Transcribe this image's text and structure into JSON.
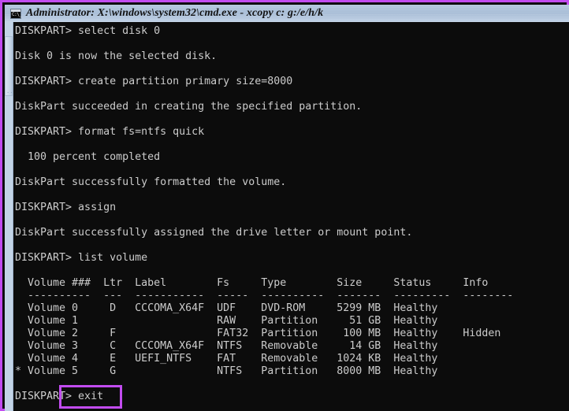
{
  "window": {
    "title": "Administrator: X:\\windows\\system32\\cmd.exe - xcopy  c: g:/e/h/k",
    "icon_name": "cmd-console-icon",
    "icon_glyph": "C:\\_",
    "border_color": "#c24cf0",
    "titlebar_color": "#b0c4da",
    "console_bg": "#0c0c0c",
    "console_fg": "#cccccc"
  },
  "scrollbar": {
    "name": "vertical-scrollbar",
    "dots": "···"
  },
  "console": {
    "lines": [
      "DISKPART> select disk 0",
      "",
      "Disk 0 is now the selected disk.",
      "",
      "DISKPART> create partition primary size=8000",
      "",
      "DiskPart succeeded in creating the specified partition.",
      "",
      "DISKPART> format fs=ntfs quick",
      "",
      "  100 percent completed",
      "",
      "DiskPart successfully formatted the volume.",
      "",
      "DISKPART> assign",
      "",
      "DiskPart successfully assigned the drive letter or mount point.",
      "",
      "DISKPART> list volume",
      "",
      "  Volume ###  Ltr  Label        Fs     Type        Size     Status     Info",
      "  ----------  ---  -----------  -----  ----------  -------  ---------  --------",
      "  Volume 0     D   CCCOMA_X64F  UDF    DVD-ROM     5299 MB  Healthy",
      "  Volume 1                      RAW    Partition     51 GB  Healthy",
      "  Volume 2     F                FAT32  Partition    100 MB  Healthy    Hidden",
      "  Volume 3     C   CCCOMA_X64F  NTFS   Removable     14 GB  Healthy",
      "  Volume 4     E   UEFI_NTFS    FAT    Removable   1024 KB  Healthy",
      "* Volume 5     G                NTFS   Partition   8000 MB  Healthy",
      "",
      "DISKPART> exit"
    ]
  },
  "annotation": {
    "name": "exit-command-highlight",
    "target_text": "> exit",
    "color": "#c24cf0"
  },
  "terminal_table": {
    "headers": [
      "Volume ###",
      "Ltr",
      "Label",
      "Fs",
      "Type",
      "Size",
      "Status",
      "Info"
    ],
    "rows": [
      {
        "selected": false,
        "volume": "Volume 0",
        "ltr": "D",
        "label": "CCCOMA_X64F",
        "fs": "UDF",
        "type": "DVD-ROM",
        "size": "5299 MB",
        "status": "Healthy",
        "info": ""
      },
      {
        "selected": false,
        "volume": "Volume 1",
        "ltr": "",
        "label": "",
        "fs": "RAW",
        "type": "Partition",
        "size": "51 GB",
        "status": "Healthy",
        "info": ""
      },
      {
        "selected": false,
        "volume": "Volume 2",
        "ltr": "F",
        "label": "",
        "fs": "FAT32",
        "type": "Partition",
        "size": "100 MB",
        "status": "Healthy",
        "info": "Hidden"
      },
      {
        "selected": false,
        "volume": "Volume 3",
        "ltr": "C",
        "label": "CCCOMA_X64F",
        "fs": "NTFS",
        "type": "Removable",
        "size": "14 GB",
        "status": "Healthy",
        "info": ""
      },
      {
        "selected": false,
        "volume": "Volume 4",
        "ltr": "E",
        "label": "UEFI_NTFS",
        "fs": "FAT",
        "type": "Removable",
        "size": "1024 KB",
        "status": "Healthy",
        "info": ""
      },
      {
        "selected": true,
        "volume": "Volume 5",
        "ltr": "G",
        "label": "",
        "fs": "NTFS",
        "type": "Partition",
        "size": "8000 MB",
        "status": "Healthy",
        "info": ""
      }
    ]
  }
}
